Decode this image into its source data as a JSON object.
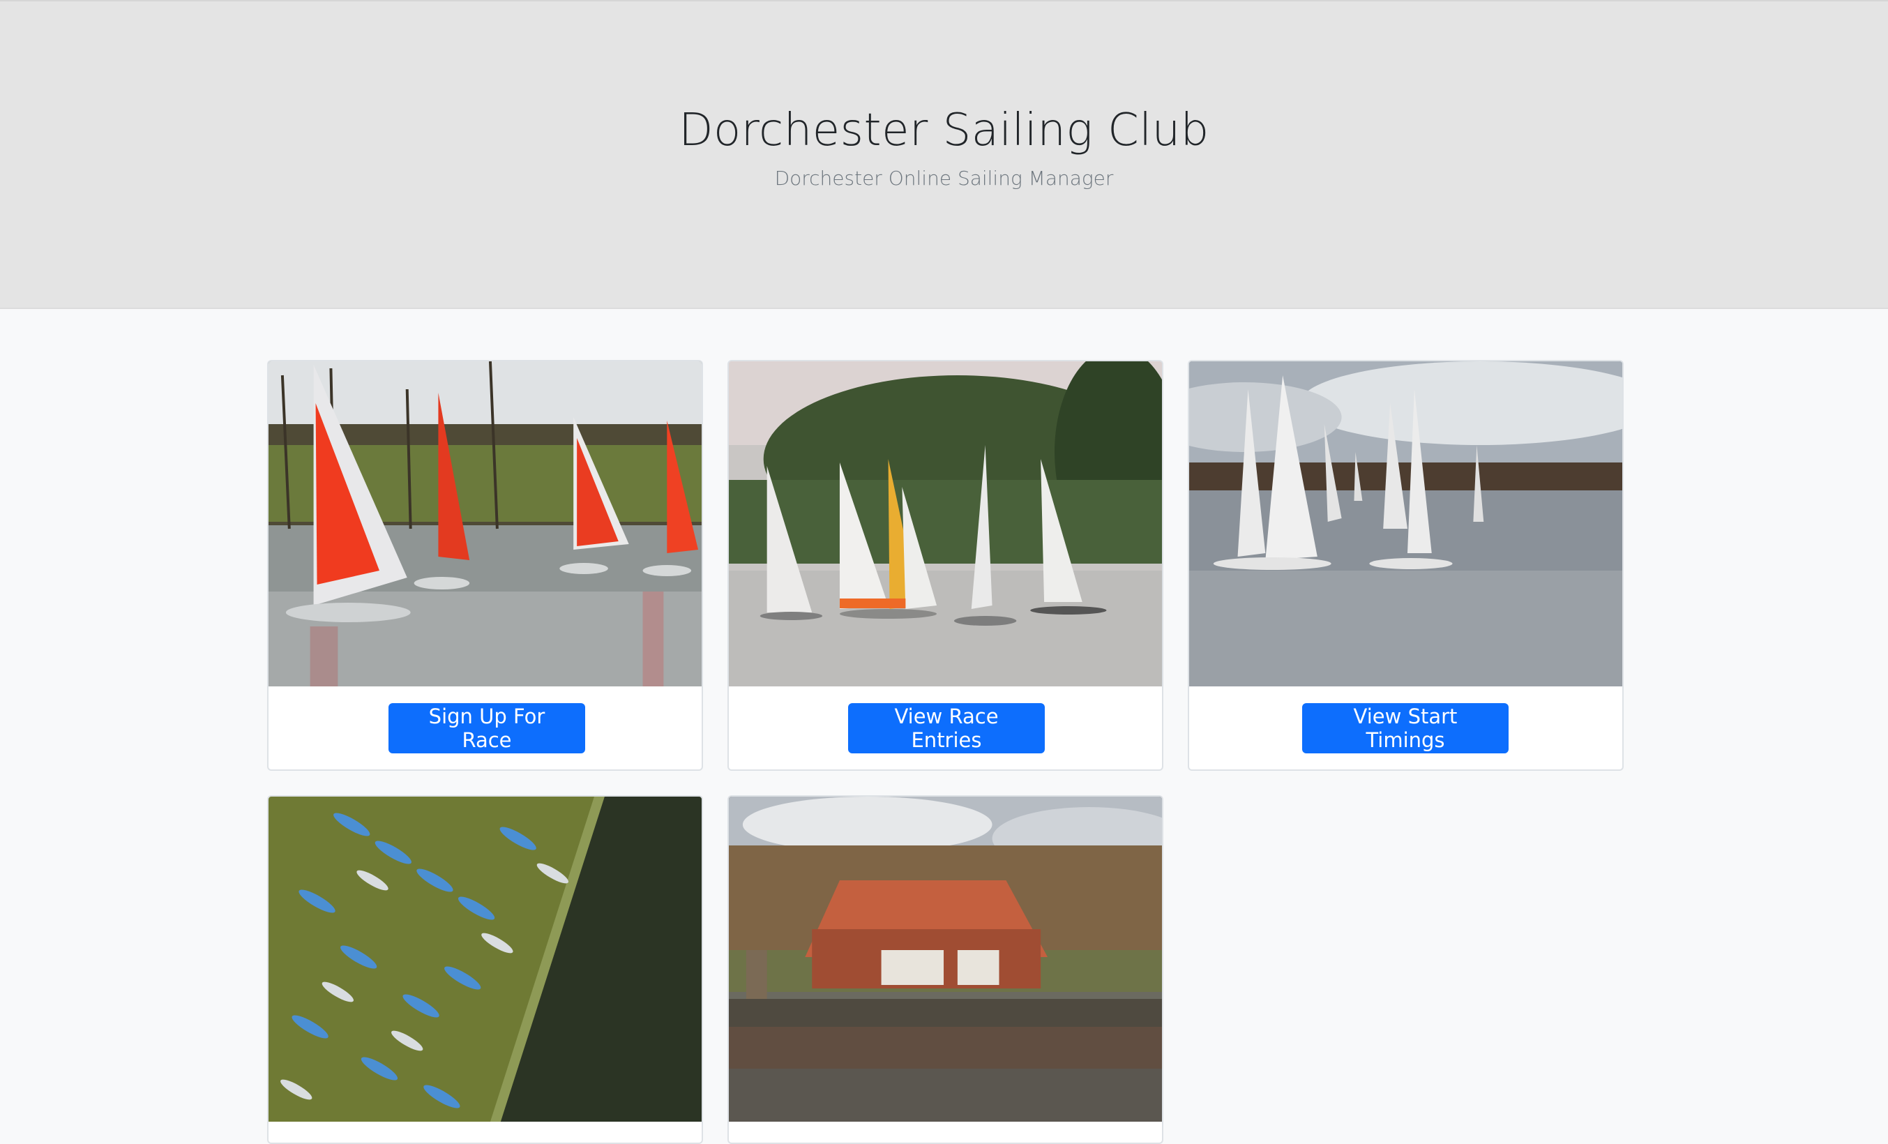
{
  "header": {
    "title": "Dorchester Sailing Club",
    "subtitle": "Dorchester Online Sailing Manager"
  },
  "cards": [
    {
      "image": "photo-red-sail-dinghies",
      "button_label": "Sign Up For Race"
    },
    {
      "image": "photo-white-sail-dinghies-trees",
      "button_label": "View Race Entries"
    },
    {
      "image": "photo-dinghies-open-water",
      "button_label": "View Start Timings"
    },
    {
      "image": "photo-aerial-boat-park"
    },
    {
      "image": "photo-clubhouse-lake"
    }
  ],
  "colors": {
    "header_bg": "#e4e4e4",
    "page_bg": "#f8f9fa",
    "button": "#0d6efd"
  }
}
